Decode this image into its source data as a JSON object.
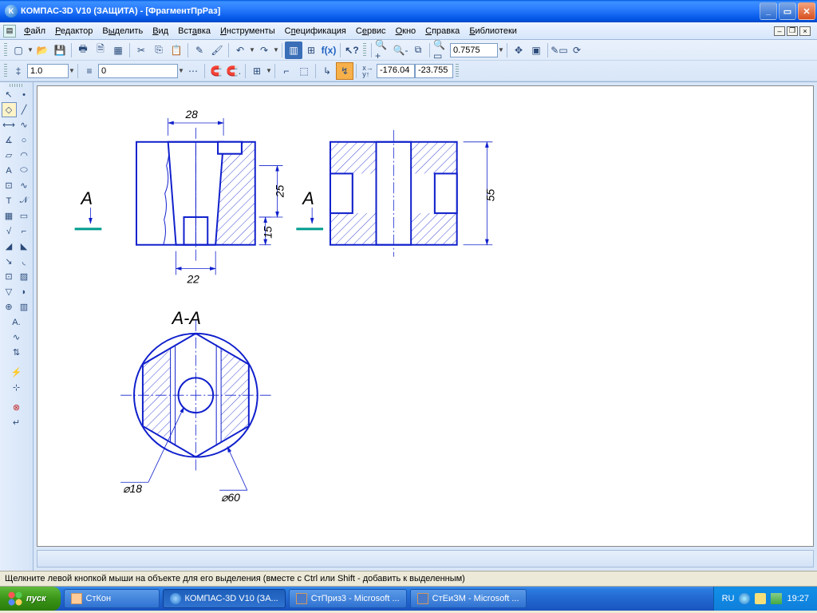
{
  "title": "КОМПАС-3D V10 (ЗАЩИТА) - [ФрагментПрРаз]",
  "menu": {
    "file": "Файл",
    "editor": "Редактор",
    "select": "Выделить",
    "view": "Вид",
    "insert": "Вставка",
    "tools": "Инструменты",
    "spec": "Спецификация",
    "service": "Сервис",
    "window": "Окно",
    "help": "Справка",
    "libs": "Библиотеки"
  },
  "toolbar": {
    "zoom_value": "0.7575",
    "step_value": "1.0",
    "layer_value": "0",
    "coord_x": "-176.04",
    "coord_y": "-23.755"
  },
  "drawing": {
    "dim_top": "28",
    "dim_bottom": "22",
    "dim_right1": "25",
    "dim_right2": "15",
    "dim_side": "55",
    "section_letter": "А",
    "section_title": "А-А",
    "diameter1": "⌀18",
    "diameter2": "⌀60"
  },
  "status": "Щелкните левой кнопкой мыши на объекте для его выделения (вместе с Ctrl или Shift - добавить к выделенным)",
  "taskbar": {
    "start": "пуск",
    "t1": "СтКон",
    "t2": "КОМПАС-3D V10 (ЗА...",
    "t3": "СтПриз3 - Microsoft ...",
    "t4": "СтЕиЗМ - Microsoft ...",
    "lang": "RU",
    "time": "19:27"
  }
}
